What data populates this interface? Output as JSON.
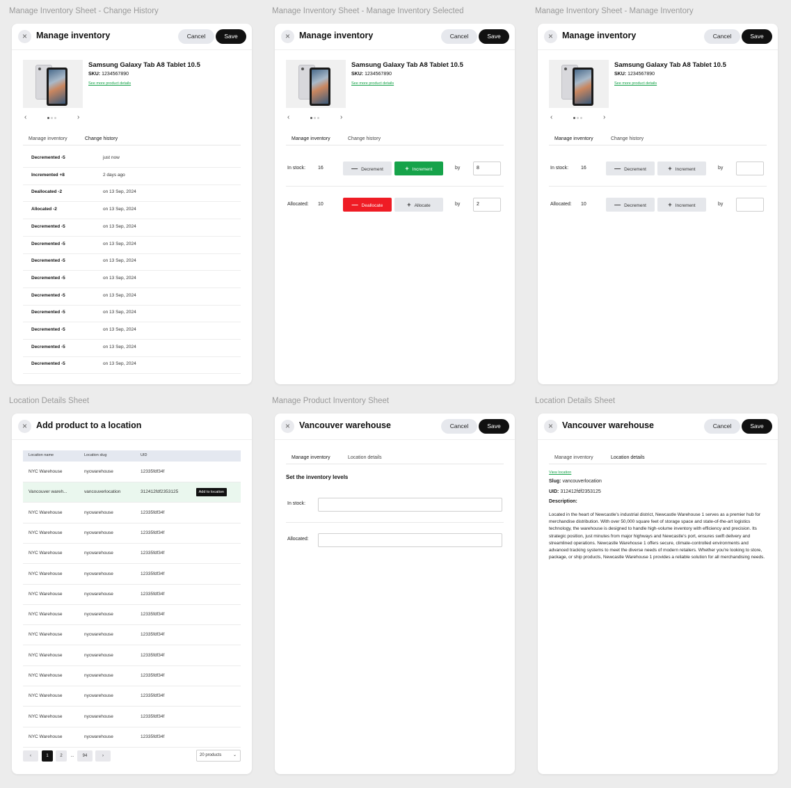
{
  "frames": [
    "Manage Inventory Sheet - Change History",
    "Manage Inventory Sheet - Manage Inventory Selected",
    "Manage Inventory Sheet - Manage Inventory",
    "Location Details Sheet",
    "Manage Product Inventory Sheet",
    "Location Details Sheet"
  ],
  "common": {
    "close_icon": "×",
    "cancel": "Cancel",
    "save": "Save",
    "prev": "‹",
    "next": "›",
    "minus": "—",
    "plus": "+"
  },
  "manage_inventory": {
    "title": "Manage inventory",
    "product": {
      "name": "Samsung Galaxy Tab A8 Tablet 10.5",
      "sku_label": "SKU:",
      "sku": "1234567890",
      "link": "See more product details",
      "image_icon": "tablet-image"
    },
    "tabs": [
      "Manage inventory",
      "Change history"
    ],
    "in_stock_label": "In stock:",
    "in_stock_value": "16",
    "allocated_label": "Allocated:",
    "allocated_value": "10",
    "decrement": "Decrement",
    "increment": "Increment",
    "deallocate": "Deallocate",
    "allocate": "Allocate",
    "by": "by",
    "selected_in_stock_by": "8",
    "selected_allocated_by": "2",
    "history": [
      {
        "event": "Decremented -5",
        "time": "just now"
      },
      {
        "event": "Incremented +8",
        "time": "2 days ago"
      },
      {
        "event": "Deallocated -2",
        "time": "on 13 Sep, 2024"
      },
      {
        "event": "Allocated -2",
        "time": "on 13 Sep, 2024"
      },
      {
        "event": "Decremented -5",
        "time": "on 13 Sep, 2024"
      },
      {
        "event": "Decremented -5",
        "time": "on 13 Sep, 2024"
      },
      {
        "event": "Decremented -5",
        "time": "on 13 Sep, 2024"
      },
      {
        "event": "Decremented -5",
        "time": "on 13 Sep, 2024"
      },
      {
        "event": "Decremented -5",
        "time": "on 13 Sep, 2024"
      },
      {
        "event": "Decremented -5",
        "time": "on 13 Sep, 2024"
      },
      {
        "event": "Decremented -5",
        "time": "on 13 Sep, 2024"
      },
      {
        "event": "Decremented -5",
        "time": "on 13 Sep, 2024"
      },
      {
        "event": "Decremented -5",
        "time": "on 13 Sep, 2024"
      }
    ],
    "colors": {
      "accent": "#16a34a",
      "danger": "#ef1c25"
    }
  },
  "add_product": {
    "title": "Add product to a location",
    "columns": [
      "Location name",
      "Location slug",
      "UID"
    ],
    "rows": [
      {
        "name": "NYC Warehouse",
        "slug": "nycwarehouse",
        "uid": "12335fdf34f"
      },
      {
        "name": "Vancouver wareh...",
        "slug": "vancouverlocation",
        "uid": "312412fdf2353125",
        "highlight": true
      },
      {
        "name": "NYC Warehouse",
        "slug": "nycwarehouse",
        "uid": "12335fdf34f"
      },
      {
        "name": "NYC Warehouse",
        "slug": "nycwarehouse",
        "uid": "12335fdf34f"
      },
      {
        "name": "NYC Warehouse",
        "slug": "nycwarehouse",
        "uid": "12335fdf34f"
      },
      {
        "name": "NYC Warehouse",
        "slug": "nycwarehouse",
        "uid": "12335fdf34f"
      },
      {
        "name": "NYC Warehouse",
        "slug": "nycwarehouse",
        "uid": "12335fdf34f"
      },
      {
        "name": "NYC Warehouse",
        "slug": "nycwarehouse",
        "uid": "12335fdf34f"
      },
      {
        "name": "NYC Warehouse",
        "slug": "nycwarehouse",
        "uid": "12335fdf34f"
      },
      {
        "name": "NYC Warehouse",
        "slug": "nycwarehouse",
        "uid": "12335fdf34f"
      },
      {
        "name": "NYC Warehouse",
        "slug": "nycwarehouse",
        "uid": "12335fdf34f"
      },
      {
        "name": "NYC Warehouse",
        "slug": "nycwarehouse",
        "uid": "12335fdf34f"
      },
      {
        "name": "NYC Warehouse",
        "slug": "nycwarehouse",
        "uid": "12335fdf34f"
      },
      {
        "name": "NYC Warehouse",
        "slug": "nycwarehouse",
        "uid": "12335fdf34f"
      }
    ],
    "add_button": "Add to location",
    "pagination": {
      "prev": "‹",
      "pages": [
        "1",
        "2",
        "...",
        "94"
      ],
      "next": "›",
      "page_size": "20 products",
      "chevron": "⌄"
    }
  },
  "product_inventory": {
    "title": "Vancouver warehouse",
    "tabs": [
      "Manage inventory",
      "Location details"
    ],
    "section_title": "Set the inventory levels",
    "in_stock_label": "In stock:",
    "allocated_label": "Allocated:"
  },
  "location_details": {
    "title": "Vancouver warehouse",
    "tabs": [
      "Manage inventory",
      "Location details"
    ],
    "view_link": "View location",
    "slug_label": "Slug:",
    "slug": "vancouverlocation",
    "uid_label": "UID:",
    "uid": "312412fdf2353125",
    "description_label": "Description:",
    "description": "Located in the heart of Newcastle's industrial district, Newcastle Warehouse 1 serves as a premier hub for merchandise distribution. With over 50,000 square feet of storage space and state-of-the-art logistics technology, the warehouse is designed to handle high-volume inventory with efficiency and precision. Its strategic position, just minutes from major highways and Newcastle's port, ensures swift delivery and streamlined operations. Newcastle Warehouse 1 offers secure, climate-controlled environments and advanced tracking systems to meet the diverse needs of modern retailers. Whether you're looking to store, package, or ship products, Newcastle Warehouse 1 provides a reliable solution for all merchandising needs."
  }
}
